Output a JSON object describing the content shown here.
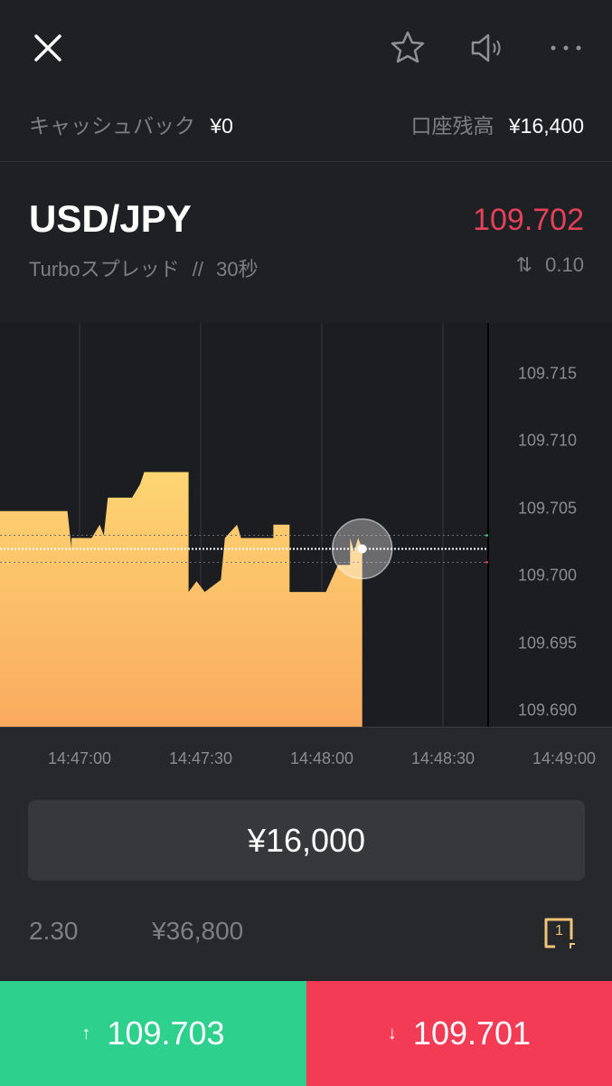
{
  "header": {
    "close_icon": "close-icon",
    "favorite_icon": "star-icon",
    "sound_icon": "speaker-icon",
    "more_icon": "more-dots-icon"
  },
  "account": {
    "cashback_label": "キャッシュバック",
    "cashback_value": "¥0",
    "balance_label": "口座残高",
    "balance_value": "¥16,400"
  },
  "instrument": {
    "pair": "USD/JPY",
    "price": "109.702",
    "price_color": "#e5415a",
    "mode": "Turboスプレッド",
    "separator": "//",
    "duration": "30秒",
    "spread_icon": "up-down-arrows-icon",
    "spread": "0.10"
  },
  "chart_data": {
    "type": "area",
    "x_ticks": [
      "14:47:00",
      "14:47:30",
      "14:48:00",
      "14:48:30",
      "14:49:00"
    ],
    "y_ticks": [
      "109.715",
      "109.710",
      "109.705",
      "109.700",
      "109.695",
      "109.690"
    ],
    "ylim": [
      109.689,
      109.7175
    ],
    "grid": "vertical",
    "current_price": 109.702,
    "ask_line": 109.703,
    "bid_line": 109.701,
    "fill_colors": [
      "#fdd572",
      "#f9aa5f"
    ],
    "points": [
      [
        "14:46:40",
        109.7048
      ],
      [
        "14:46:57",
        109.7048
      ],
      [
        "14:46:58",
        109.702
      ],
      [
        "14:46:58",
        109.7028
      ],
      [
        "14:47:03",
        109.7028
      ],
      [
        "14:47:05",
        109.7038
      ],
      [
        "14:47:06",
        109.703
      ],
      [
        "14:47:07",
        109.7058
      ],
      [
        "14:47:13",
        109.7058
      ],
      [
        "14:47:15",
        109.7068
      ],
      [
        "14:47:16",
        109.7077
      ],
      [
        "14:47:27",
        109.7077
      ],
      [
        "14:47:27",
        109.6988
      ],
      [
        "14:47:29",
        109.6996
      ],
      [
        "14:47:31",
        109.6988
      ],
      [
        "14:47:35",
        109.6997
      ],
      [
        "14:47:36",
        109.7028
      ],
      [
        "14:47:39",
        109.7038
      ],
      [
        "14:47:40",
        109.7028
      ],
      [
        "14:47:48",
        109.7028
      ],
      [
        "14:47:48",
        109.7038
      ],
      [
        "14:47:52",
        109.7038
      ],
      [
        "14:47:52",
        109.6988
      ],
      [
        "14:48:01",
        109.6988
      ],
      [
        "14:48:04",
        109.7008
      ],
      [
        "14:48:07",
        109.7008
      ],
      [
        "14:48:07",
        109.7028
      ],
      [
        "14:48:08",
        109.7018
      ],
      [
        "14:48:09",
        109.7028
      ],
      [
        "14:48:10",
        109.702
      ]
    ]
  },
  "trade": {
    "amount": "¥16,000",
    "payout_rate": "2.30",
    "payout_amount": "¥36,800",
    "tutorial_icon": "one-click-icon",
    "tutorial_label": "1"
  },
  "buttons": {
    "high_arrow": "↑",
    "high_price": "109.703",
    "high_color": "#2dd08d",
    "low_arrow": "↓",
    "low_price": "109.701",
    "low_color": "#f43b55"
  }
}
